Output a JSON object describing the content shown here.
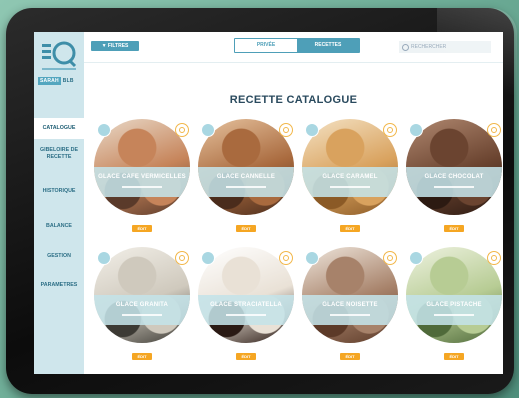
{
  "app": {
    "user_label": "SARAH",
    "user_suffix": "BLB"
  },
  "sidebar": {
    "items": [
      {
        "label": "CATALOGUE",
        "active": true
      },
      {
        "label": "GIBELOIRE DE RECETTE",
        "active": false
      },
      {
        "label": "HISTORIQUE",
        "active": false
      },
      {
        "label": "BALANCE",
        "active": false
      },
      {
        "label": "GESTION",
        "active": false
      },
      {
        "label": "PARAMETRES",
        "active": false
      }
    ]
  },
  "topbar": {
    "filter_label": "▼ FILTRES",
    "tabs": [
      {
        "label": "PRIVÉE",
        "active": false
      },
      {
        "label": "RECETTES",
        "active": true
      }
    ],
    "search_placeholder": "RECHERCHER"
  },
  "main": {
    "title": "RECETTE CATALOGUE"
  },
  "recipes": [
    {
      "name": "GLACE CAFE VERMICELLES",
      "price": "ÉDIT",
      "colors": [
        "#5a3a2a",
        "#c6845a",
        "#e9d9c8"
      ]
    },
    {
      "name": "GLACE CANNELLE",
      "price": "ÉDIT",
      "colors": [
        "#4a2c1c",
        "#a96a3e",
        "#e6c29e"
      ]
    },
    {
      "name": "GLACE CARAMEL",
      "price": "ÉDIT",
      "colors": [
        "#8b5a26",
        "#d9a25e",
        "#f4e2c4"
      ]
    },
    {
      "name": "GLACE CHOCOLAT",
      "price": "ÉDIT",
      "colors": [
        "#2c1a12",
        "#6b4430",
        "#b08870"
      ]
    },
    {
      "name": "GLACE GRANITA",
      "price": "ÉDIT",
      "colors": [
        "#3c3a34",
        "#cfc9bd",
        "#f2efe8"
      ]
    },
    {
      "name": "GLACE STRACIATELLA",
      "price": "ÉDIT",
      "colors": [
        "#2a1a14",
        "#e9e1d6",
        "#ffffff"
      ]
    },
    {
      "name": "GLACE NOISETTE",
      "price": "ÉDIT",
      "colors": [
        "#5c3a28",
        "#a7826a",
        "#efe6dc"
      ]
    },
    {
      "name": "GLACE PISTACHE",
      "price": "ÉDIT",
      "colors": [
        "#4f6a3a",
        "#b7cc94",
        "#eef2e0"
      ]
    }
  ]
}
